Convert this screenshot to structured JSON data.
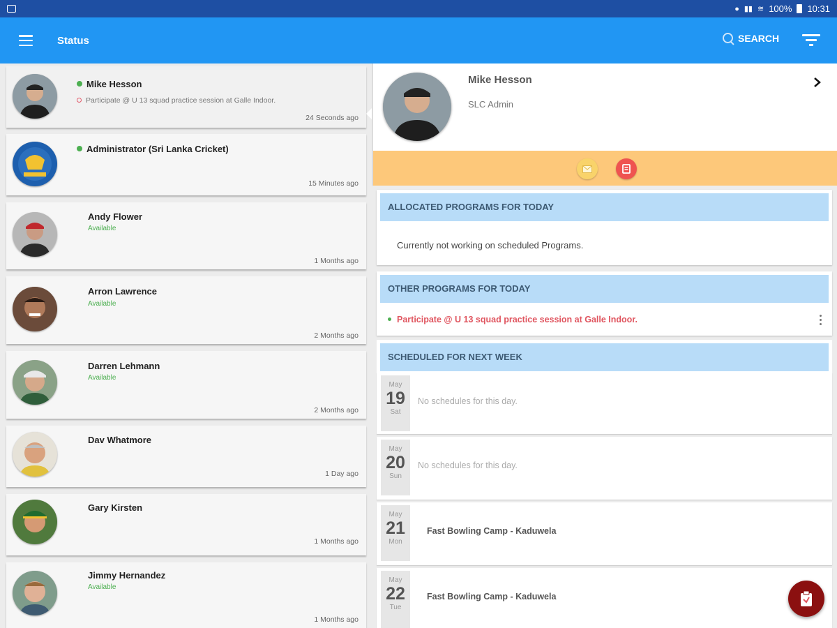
{
  "status_bar": {
    "battery": "100%",
    "time": "10:31"
  },
  "app_bar": {
    "title": "Status",
    "search_label": "SEARCH"
  },
  "contacts": [
    {
      "name": "Mike Hesson",
      "online": true,
      "task": "Participate @ U 13 squad practice session at Galle Indoor.",
      "time": "24 Seconds ago",
      "active": true
    },
    {
      "name": "Administrator (Sri Lanka Cricket)",
      "online": true,
      "time": "15 Minutes ago"
    },
    {
      "name": "Andy Flower",
      "status": "Available",
      "time": "1 Months ago"
    },
    {
      "name": "Arron Lawrence",
      "status": "Available",
      "time": "2 Months ago"
    },
    {
      "name": "Darren Lehmann",
      "status": "Available",
      "time": "2 Months ago"
    },
    {
      "name": "Dav Whatmore",
      "time": "1 Day ago"
    },
    {
      "name": "Gary Kirsten",
      "time": "1 Months ago"
    },
    {
      "name": "Jimmy Hernandez",
      "status": "Available",
      "time": "1 Months ago"
    }
  ],
  "profile": {
    "name": "Mike Hesson",
    "role": "SLC Admin"
  },
  "allocated": {
    "heading": "ALLOCATED PROGRAMS FOR TODAY",
    "empty_text": "Currently not working on scheduled Programs."
  },
  "other": {
    "heading": "OTHER PROGRAMS FOR TODAY",
    "item": "Participate @ U 13 squad practice session at Galle Indoor."
  },
  "schedule": {
    "heading": "SCHEDULED FOR NEXT WEEK",
    "days": [
      {
        "month": "May",
        "day": "19",
        "weekday": "Sat",
        "text": "No schedules for this day.",
        "has_event": false
      },
      {
        "month": "May",
        "day": "20",
        "weekday": "Sun",
        "text": "No schedules for this day.",
        "has_event": false
      },
      {
        "month": "May",
        "day": "21",
        "weekday": "Mon",
        "text": "Fast Bowling Camp - Kaduwela",
        "has_event": true
      },
      {
        "month": "May",
        "day": "22",
        "weekday": "Tue",
        "text": "Fast Bowling Camp - Kaduwela",
        "has_event": true
      }
    ]
  },
  "colors": {
    "primary": "#2196f3",
    "status_bar": "#1e4fa3",
    "action_bar": "#fdc87a",
    "section_header": "#b8dcf8",
    "online": "#4caf50",
    "program_text": "#e0555f",
    "fab": "#8b1010"
  },
  "icons": {
    "menu": "hamburger-icon",
    "search": "search-icon",
    "filter": "filter-icon",
    "mail": "mail-icon",
    "note": "note-icon",
    "fab": "clipboard-icon"
  }
}
